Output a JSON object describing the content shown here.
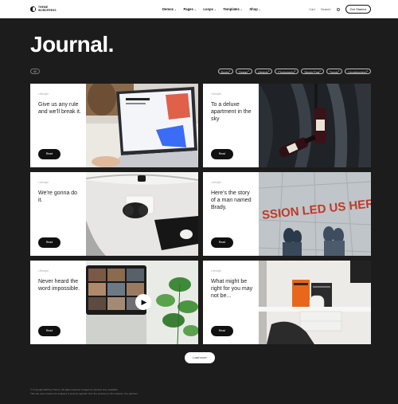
{
  "header": {
    "logo_text_1": "THEME",
    "logo_text_2": "WORDPRESS",
    "nav": [
      {
        "label": "Demos",
        "caret": true
      },
      {
        "label": "Pages",
        "caret": true
      },
      {
        "label": "Loops",
        "caret": true
      },
      {
        "label": "Templates",
        "caret": true
      },
      {
        "label": "Shop",
        "caret": true
      }
    ],
    "cart_label": "Cart",
    "search_label": "Search",
    "cta_label": "Get Started"
  },
  "page": {
    "title": "Journal."
  },
  "filters": {
    "all_label": "All",
    "items": [
      {
        "label": "Books",
        "count": "1"
      },
      {
        "label": "Design",
        "count": "2"
      },
      {
        "label": "Lifestyle",
        "count": "3"
      },
      {
        "label": "Photography",
        "count": "2"
      },
      {
        "label": "Simple Post",
        "count": "1"
      },
      {
        "label": "Trends",
        "count": "4"
      },
      {
        "label": "Uncategorized",
        "count": "1"
      }
    ]
  },
  "cards": [
    {
      "category": "Lifestyle",
      "title": "Give us any rule and we'll break it.",
      "button": "Read",
      "image": "laptop-desk"
    },
    {
      "category": "Lifestyle",
      "title": "To a deluxe apartment in the sky",
      "button": "Read",
      "image": "wine-bottle"
    },
    {
      "category": "Lifestyle",
      "title": "We're gonna do it.",
      "button": "Read",
      "image": "headphones-desk"
    },
    {
      "category": "Lifestyle",
      "title": "Here's the story of a man named Brady.",
      "button": "Read",
      "image": "street-sign"
    },
    {
      "category": "Lifestyle",
      "title": "Never heard the word impossible.",
      "button": "Read",
      "image": "video-call-plant"
    },
    {
      "category": "Lifestyle",
      "title": "What might be right for you may not be...",
      "button": "Read",
      "image": "office-desk"
    }
  ],
  "sign_text": "SSION LED US HERE",
  "load_more_label": "Load more",
  "footer": {
    "line1": "© Copyright 2023 by Theme. All rights reserved. Images for preview only, available.",
    "line2": "This site uses cookies for analytics & security together from the services on this website. Our partners."
  },
  "colors": {
    "page_bg": "#1c1c1c",
    "card_bg": "#ffffff",
    "button_bg": "#111111",
    "accent_orange": "#e8671a",
    "accent_blue": "#3b6cf6"
  }
}
